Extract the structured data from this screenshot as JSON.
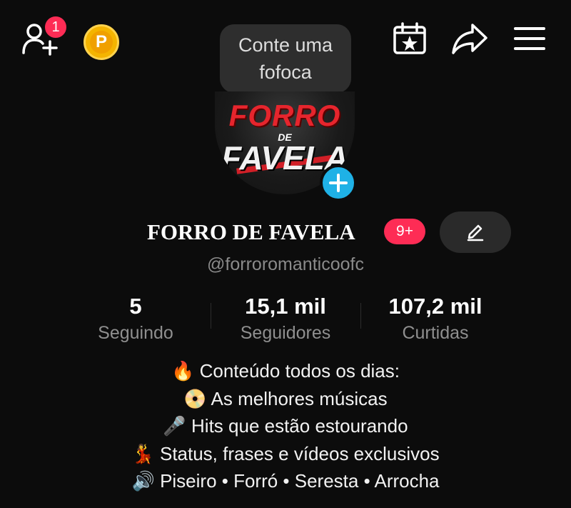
{
  "header": {
    "notification_count": "1",
    "coin_label": "P",
    "bubble_line1": "Conte uma",
    "bubble_line2": "fofoca"
  },
  "avatar": {
    "line1": "FORRO",
    "line2": "DE",
    "line3": "FAVELA"
  },
  "profile": {
    "name": "FORRO DE FAVELA",
    "badge": "9+",
    "username": "@forroromanticoofc"
  },
  "stats": [
    {
      "value": "5",
      "label": "Seguindo"
    },
    {
      "value": "15,1 mil",
      "label": "Seguidores"
    },
    {
      "value": "107,2 mil",
      "label": "Curtidas"
    }
  ],
  "bio": [
    "🔥 Conteúdo todos os dias:",
    "📀 As melhores músicas",
    "🎤 Hits que estão estourando",
    "💃 Status, frases e vídeos exclusivos",
    "🔊 Piseiro • Forró • Seresta • Arrocha"
  ],
  "colors": {
    "background": "#0c0c0c",
    "accent_red": "#fe2c55",
    "plus_blue": "#1fb1e6",
    "coin_gold": "#f4b400",
    "muted_text": "#8f8f8f"
  },
  "icons": {
    "add_friend": "add-friend-icon",
    "coin": "coin-icon",
    "calendar": "calendar-star-icon",
    "share": "share-arrow-icon",
    "menu": "hamburger-menu-icon",
    "plus": "plus-icon",
    "edit": "pencil-icon"
  }
}
